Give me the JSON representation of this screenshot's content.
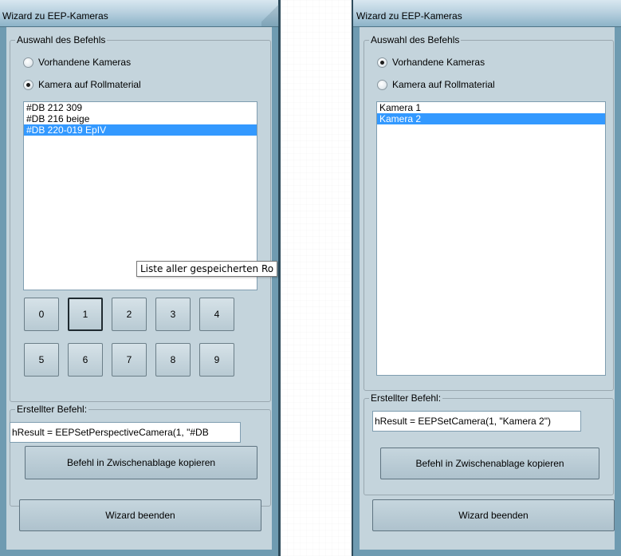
{
  "left_window": {
    "title": "Wizard zu EEP-Kameras",
    "group_befehl": "Auswahl des Befehls",
    "radio_vorhandene": "Vorhandene Kameras",
    "radio_rollmaterial": "Kamera auf Rollmaterial",
    "selected_radio": "radio_rollmaterial",
    "list_items": [
      "#DB 212 309",
      "#DB 216 beige",
      "#DB 220-019 EpIV"
    ],
    "selected_list_index": 2,
    "tooltip": "Liste aller gespeicherten Ro",
    "digits": [
      "0",
      "1",
      "2",
      "3",
      "4",
      "5",
      "6",
      "7",
      "8",
      "9"
    ],
    "focused_digit": "1",
    "group_erstellt": "Erstellter Befehl:",
    "command": "hResult = EEPSetPerspectiveCamera(1, \"#DB",
    "copy_button": "Befehl in Zwischenablage kopieren",
    "end_button": "Wizard beenden"
  },
  "right_window": {
    "title": "Wizard zu EEP-Kameras",
    "group_befehl": "Auswahl des Befehls",
    "radio_vorhandene": "Vorhandene Kameras",
    "radio_rollmaterial": "Kamera auf Rollmaterial",
    "selected_radio": "radio_vorhandene",
    "list_items": [
      "Kamera 1",
      "Kamera 2"
    ],
    "selected_list_index": 1,
    "group_erstellt": "Erstellter Befehl:",
    "command": "hResult = EEPSetCamera(1, \"Kamera 2\")",
    "copy_button": "Befehl in Zwischenablage kopieren",
    "end_button": "Wizard beenden"
  },
  "colors": {
    "window_frame": "#6f9bb1",
    "client_bg": "#c4d4dc",
    "selection": "#3399ff"
  }
}
